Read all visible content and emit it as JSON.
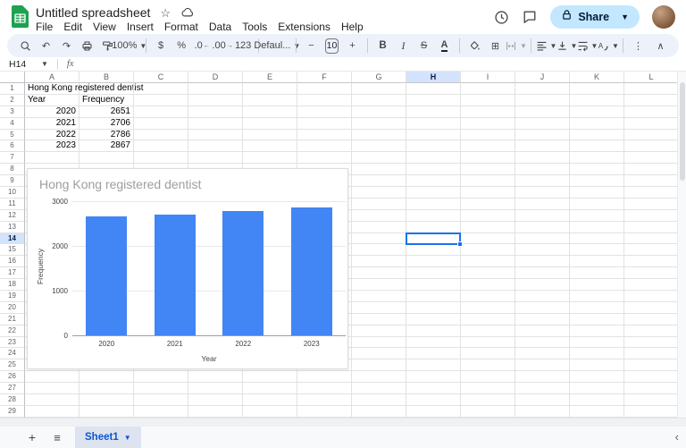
{
  "header": {
    "title": "Untitled spreadsheet",
    "menus": [
      "File",
      "Edit",
      "View",
      "Insert",
      "Format",
      "Data",
      "Tools",
      "Extensions",
      "Help"
    ],
    "share_label": "Share"
  },
  "toolbar": {
    "items": [
      {
        "t": "icon",
        "name": "search"
      },
      {
        "t": "glyph",
        "name": "undo",
        "g": "↶"
      },
      {
        "t": "glyph",
        "name": "redo",
        "g": "↷"
      },
      {
        "t": "icon",
        "name": "print"
      },
      {
        "t": "icon",
        "name": "paint-format"
      },
      {
        "t": "glyph",
        "name": "zoom-select",
        "g": "100%",
        "caret": true
      },
      {
        "t": "div"
      },
      {
        "t": "glyph",
        "name": "format-as-currency",
        "g": "$"
      },
      {
        "t": "glyph",
        "name": "format-as-percent",
        "g": "%"
      },
      {
        "t": "glyph",
        "name": "decrease-decimal-places",
        "g": ".0",
        "sub": "←"
      },
      {
        "t": "glyph",
        "name": "increase-decimal-places",
        "g": ".00",
        "sub": "→"
      },
      {
        "t": "glyph",
        "name": "more-formats",
        "g": "123"
      },
      {
        "t": "div"
      },
      {
        "t": "glyph",
        "name": "font-select",
        "g": "Defaul...",
        "caret": true
      },
      {
        "t": "div"
      },
      {
        "t": "glyph",
        "name": "decrease-font-size",
        "g": "−"
      },
      {
        "t": "box",
        "name": "font-size",
        "g": "10"
      },
      {
        "t": "glyph",
        "name": "increase-font-size",
        "g": "+"
      },
      {
        "t": "div"
      },
      {
        "t": "glyph",
        "name": "bold",
        "g": "B",
        "cls": "bold"
      },
      {
        "t": "glyph",
        "name": "italic",
        "g": "I",
        "cls": "italic"
      },
      {
        "t": "glyph",
        "name": "strikethrough",
        "g": "S",
        "cls": "strike"
      },
      {
        "t": "glyph",
        "name": "text-color",
        "g": "A",
        "cls": "underbar"
      },
      {
        "t": "div"
      },
      {
        "t": "icon",
        "name": "fill-color"
      },
      {
        "t": "glyph",
        "name": "borders",
        "g": "⊞"
      },
      {
        "t": "icon",
        "name": "merge-cells",
        "caret": true,
        "cls": "disabled"
      },
      {
        "t": "div"
      },
      {
        "t": "icon",
        "name": "horizontal-align",
        "caret": true
      },
      {
        "t": "icon",
        "name": "vertical-align",
        "caret": true
      },
      {
        "t": "icon",
        "name": "text-wrap",
        "caret": true
      },
      {
        "t": "icon",
        "name": "text-rotation",
        "caret": true
      },
      {
        "t": "div"
      },
      {
        "t": "glyph",
        "name": "more",
        "g": "⋮"
      },
      {
        "t": "spacer"
      },
      {
        "t": "glyph",
        "name": "hide-toolbar",
        "g": "∧"
      }
    ]
  },
  "formula_bar": {
    "cell_ref": "H14",
    "fx": "fx"
  },
  "grid": {
    "columns": [
      "A",
      "B",
      "C",
      "D",
      "E",
      "F",
      "G",
      "H",
      "I",
      "J",
      "K",
      "L"
    ],
    "visible_rows": 29,
    "selected_column": "H",
    "selected_row": 14,
    "cells": [
      {
        "col": "A",
        "row": 1,
        "value": "Hong Kong registered dentist",
        "align": "left"
      },
      {
        "col": "A",
        "row": 2,
        "value": "Year",
        "align": "left"
      },
      {
        "col": "B",
        "row": 2,
        "value": "Frequency",
        "align": "left"
      },
      {
        "col": "A",
        "row": 3,
        "value": "2020",
        "align": "right"
      },
      {
        "col": "B",
        "row": 3,
        "value": "2651",
        "align": "right"
      },
      {
        "col": "A",
        "row": 4,
        "value": "2021",
        "align": "right"
      },
      {
        "col": "B",
        "row": 4,
        "value": "2706",
        "align": "right"
      },
      {
        "col": "A",
        "row": 5,
        "value": "2022",
        "align": "right"
      },
      {
        "col": "B",
        "row": 5,
        "value": "2786",
        "align": "right"
      },
      {
        "col": "A",
        "row": 6,
        "value": "2023",
        "align": "right"
      },
      {
        "col": "B",
        "row": 6,
        "value": "2867",
        "align": "right"
      }
    ]
  },
  "chart_data": {
    "type": "bar",
    "title": "Hong Kong registered dentist",
    "categories": [
      "2020",
      "2021",
      "2022",
      "2023"
    ],
    "values": [
      2651,
      2706,
      2786,
      2867
    ],
    "xlabel": "Year",
    "ylabel": "Frequency",
    "ylim": [
      0,
      3000
    ],
    "yticks": [
      0,
      1000,
      2000,
      3000
    ],
    "bar_color": "#4285f4",
    "grid": true,
    "legend": "none"
  },
  "bottom_bar": {
    "sheet_tab": "Sheet1"
  },
  "colors": {
    "accent": "#1a73e8",
    "selection_highlight": "#d3e3fd",
    "share_pill": "#c2e7ff",
    "toolbar_bg": "#edf2fa",
    "logo_green": "#1da153",
    "sheet_tab_bg": "#dde3ef",
    "sheet_tab_text": "#0b57d0",
    "chart_title_gray": "#9e9e9e"
  }
}
